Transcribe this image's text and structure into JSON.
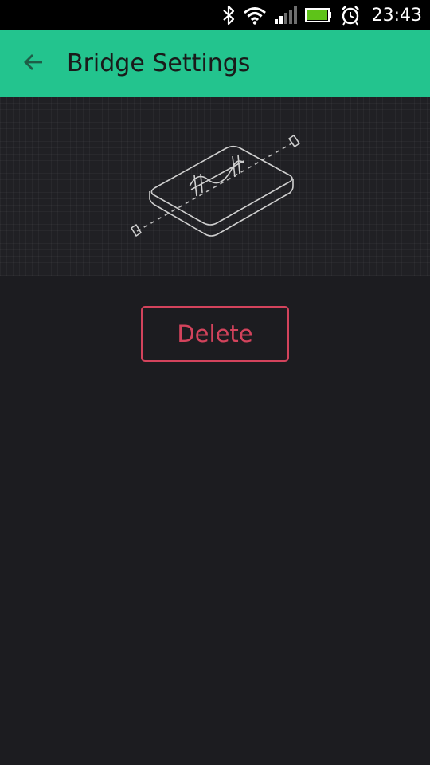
{
  "status_bar": {
    "time": "23:43",
    "icons": [
      "bluetooth-icon",
      "wifi-icon",
      "signal-icon",
      "battery-icon",
      "alarm-icon"
    ],
    "battery_color": "#5ec319"
  },
  "app_bar": {
    "title": "Bridge Settings",
    "back_icon": "arrow-left-icon",
    "background": "#23c48e"
  },
  "hero": {
    "illustration": "bridge-device-icon"
  },
  "actions": {
    "delete_label": "Delete",
    "delete_color": "#d3435c"
  }
}
